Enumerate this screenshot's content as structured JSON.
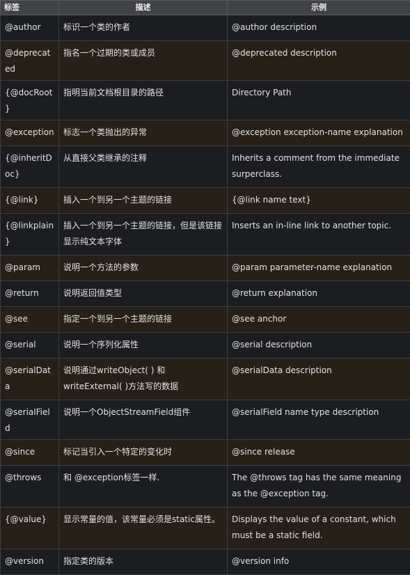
{
  "table": {
    "headers": [
      "标签",
      "描述",
      "示例"
    ],
    "rows": [
      {
        "tag": "@author",
        "desc": "标识一个类的作者",
        "example": "@author description"
      },
      {
        "tag": "@deprecated",
        "desc": "指名一个过期的类或成员",
        "example": "@deprecated description"
      },
      {
        "tag": "{@docRoot}",
        "desc": "指明当前文档根目录的路径",
        "example": "Directory Path"
      },
      {
        "tag": "@exception",
        "desc": "标志一个类抛出的异常",
        "example": "@exception exception-name explanation"
      },
      {
        "tag": "{@inheritDoc}",
        "desc": "从直接父类继承的注释",
        "example": "Inherits a comment from the immediate surperclass."
      },
      {
        "tag": "{@link}",
        "desc": "插入一个到另一个主题的链接",
        "example": "{@link name text}"
      },
      {
        "tag": "{@linkplain}",
        "desc": "插入一个到另一个主题的链接，但是该链接显示纯文本字体",
        "example": "Inserts an in-line link to another topic."
      },
      {
        "tag": "@param",
        "desc": "说明一个方法的参数",
        "example": "@param parameter-name explanation"
      },
      {
        "tag": "@return",
        "desc": "说明返回值类型",
        "example": "@return explanation"
      },
      {
        "tag": "@see",
        "desc": "指定一个到另一个主题的链接",
        "example": "@see anchor"
      },
      {
        "tag": "@serial",
        "desc": "说明一个序列化属性",
        "example": "@serial description"
      },
      {
        "tag": "@serialData",
        "desc": "说明通过writeObject( ) 和 writeExternal( )方法写的数据",
        "example": "@serialData description"
      },
      {
        "tag": "@serialField",
        "desc": "说明一个ObjectStreamField组件",
        "example": "@serialField name type description"
      },
      {
        "tag": "@since",
        "desc": "标记当引入一个特定的变化时",
        "example": "@since release"
      },
      {
        "tag": "@throws",
        "desc": "和 @exception标签一样.",
        "example": "The @throws tag has the same meaning as the @exception tag."
      },
      {
        "tag": "{@value}",
        "desc": "显示常量的值，该常量必须是static属性。",
        "example": "Displays the value of a constant, which must be a static field."
      },
      {
        "tag": "@version",
        "desc": "指定类的版本",
        "example": "@version info"
      }
    ]
  }
}
